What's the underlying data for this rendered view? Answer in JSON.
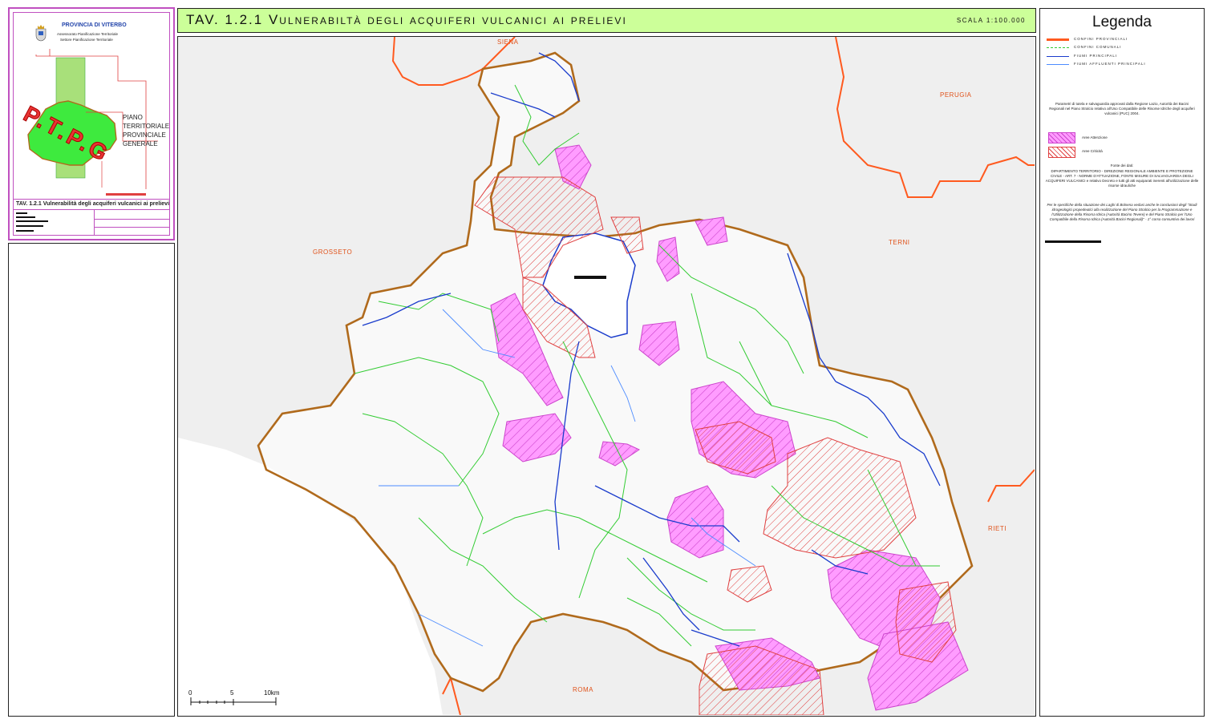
{
  "header": {
    "title": "TAV. 1.2.1 Vulnerabiltà degli acquiferi vulcanici ai prelievi",
    "scale": "SCALA 1:100.000"
  },
  "cartouche": {
    "org": "PROVINCIA DI VITERBO",
    "dept_1": "Assessorato Pianificazione Territoriale",
    "dept_2": "Settore Pianificazione Territoriale",
    "logo_text": "P.T.P.G",
    "plan_line_1": "PIANO",
    "plan_line_2": "TERRITORIALE",
    "plan_line_3": "PROVINCIALE",
    "plan_line_4": "GENERALE",
    "table_caption": "TAV. 1.2.1 Vulnerabilità degli acquiferi vulcanici ai prelievi"
  },
  "map": {
    "places": [
      "SIENA",
      "PERUGIA",
      "GROSSETO",
      "TERNI",
      "RIETI",
      "ROMA"
    ],
    "scale_ticks": [
      "0",
      "5",
      "10km"
    ]
  },
  "legend": {
    "title": "Legenda",
    "lines": [
      {
        "label": "CONFINI PROVINCIALI",
        "color": "#ff5a1f"
      },
      {
        "label": "CONFINI COMUNALI",
        "color": "#33cc33"
      },
      {
        "label": "FIUMI PRINCIPALI",
        "color": "#1a3ccc"
      },
      {
        "label": "FIUMI AFFLUENTI PRINCIPALI",
        "color": "#4d8cff"
      }
    ],
    "note": "Parametri di tutela e salvaguardia approvati dalla Regione Lazio, Autorità dei Bacini Regionali nel Piano Stralcio relativo all'Uso Compatibile delle Risorse Idriche degli acquiferi vulcanici (PUC) 2004.",
    "areas": [
      {
        "label": "Aree Attenzione",
        "color": "#cc44cc"
      },
      {
        "label": "Aree Criticità",
        "color": "#e04040"
      }
    ],
    "sources_title": "Fonte dei dati:",
    "sources_text": "DIPARTIMENTO TERRITORIO - DIREZIONE REGIONALE AMBIENTE E PROTEZIONE CIVILE - ART. 7 - NORME D'ATTUAZIONE, FONTE MISURE DI SALVAGUARDIA DEGLI ACQUIFERI VULCANICI e relativo Decreto e tutti gli atti equiparati inerenti all'utilizzazione delle risorse idrauliche",
    "footnote": "Per le specifiche della situazione dei Laghi di Bolsena vedasi anche le conclusioni degli \"Studi idrogeologici propedeutici alla realizzazione del Piano Stralcio per la Programmazione e l'Utilizzazione della Risorsa Idrica (Autorità Bacino Tevere) e del Piano Stralcio per l'Uso Compatibile della Risorsa Idrica (Autorità Bacini Regionali)\" - 1° corso consuntivo dei lavori"
  },
  "colors": {
    "title_bg": "#ccff99",
    "province_border": "#b06a1c",
    "neighbor_border": "#ff5a1f",
    "attention": "#cc44cc",
    "critical": "#e04040"
  }
}
